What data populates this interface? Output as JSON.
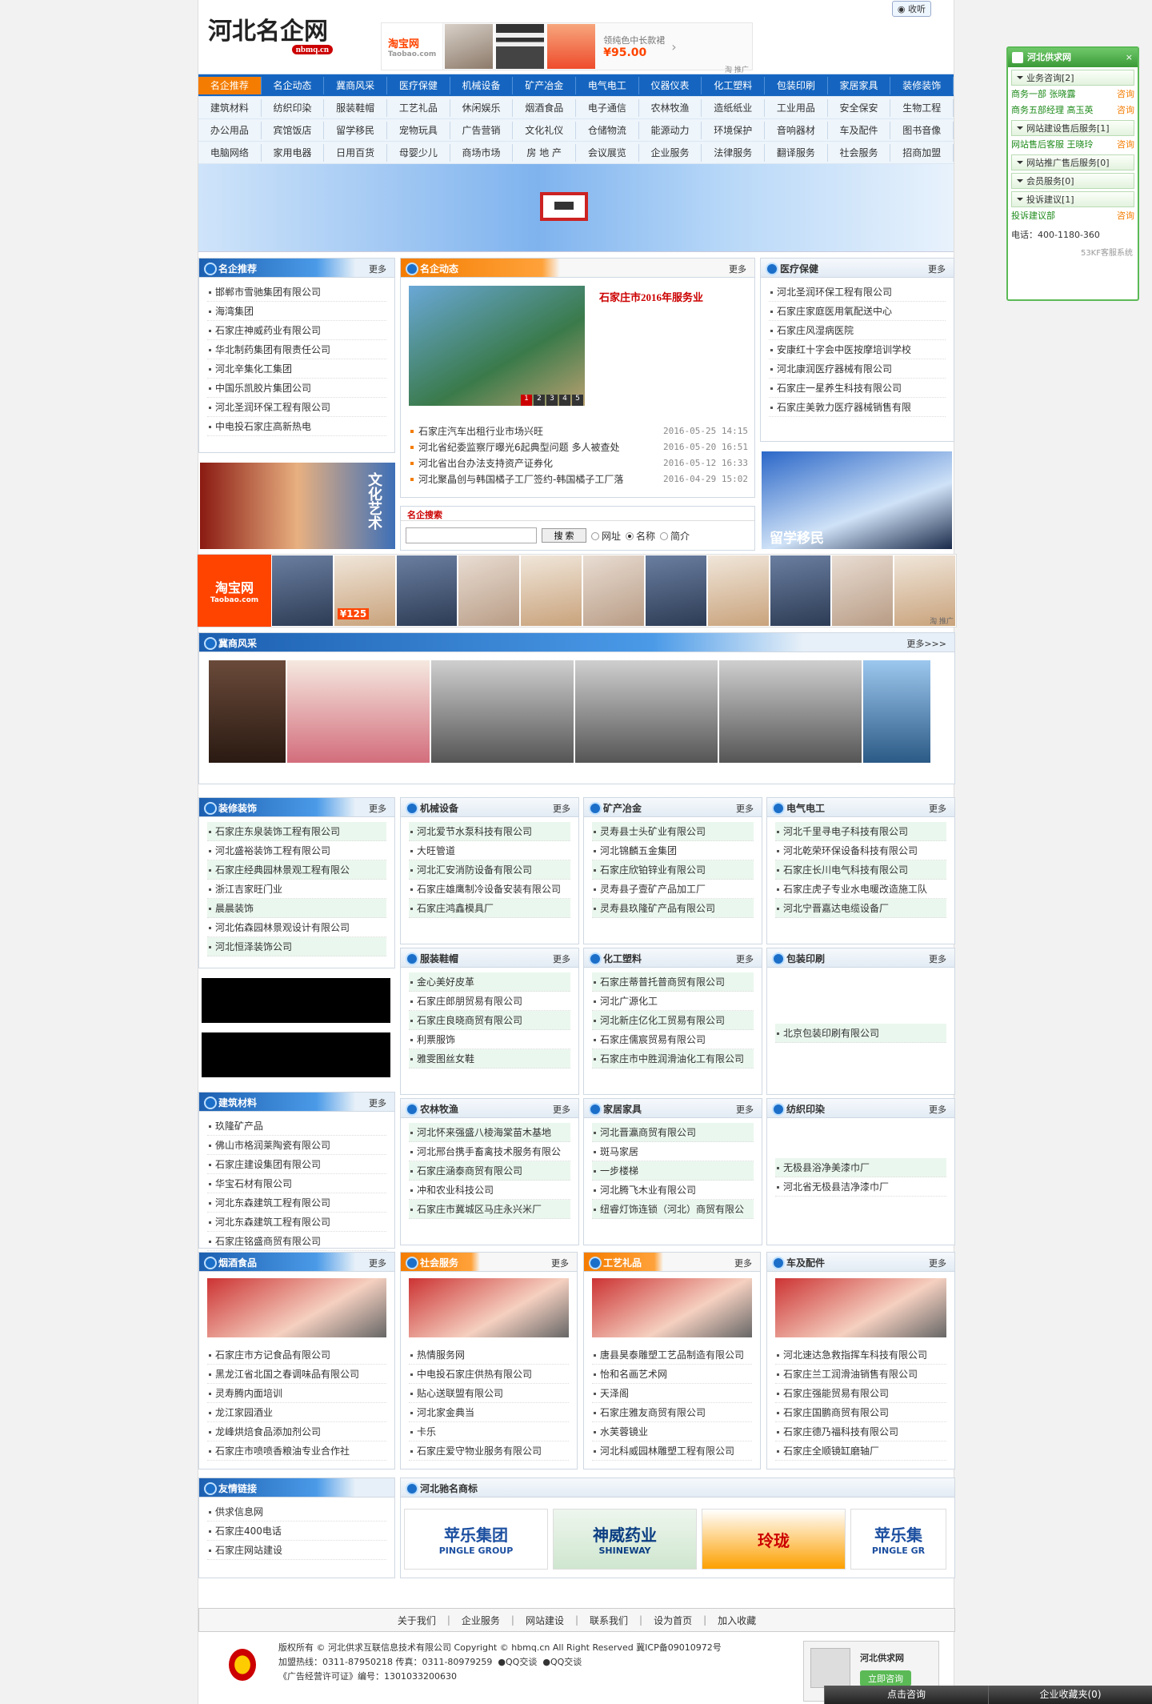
{
  "header": {
    "logo_text": "河北名企网",
    "logo_domain": "nbmq.cn",
    "banner_brand": "淘宝网",
    "banner_brand_sub": "Taobao.com",
    "banner_caption": "领纯色中长款裙",
    "banner_price": "¥95.00",
    "banner_ad_mark": "淘 推广",
    "listen_label": "收听"
  },
  "nav": {
    "rows": [
      [
        "名企推荐",
        "名企动态",
        "冀商风采",
        "医疗保健",
        "机械设备",
        "矿产冶金",
        "电气电工",
        "仪器仪表",
        "化工塑料",
        "包装印刷",
        "家居家具",
        "装修装饰"
      ],
      [
        "建筑材料",
        "纺织印染",
        "服装鞋帽",
        "工艺礼品",
        "休闲娱乐",
        "烟酒食品",
        "电子通信",
        "农林牧渔",
        "造纸纸业",
        "工业用品",
        "安全保安",
        "生物工程"
      ],
      [
        "办公用品",
        "宾馆饭店",
        "留学移民",
        "宠物玩具",
        "广告营销",
        "文化礼仪",
        "仓储物流",
        "能源动力",
        "环境保护",
        "音响器材",
        "车及配件",
        "图书音像"
      ],
      [
        "电脑网络",
        "家用电器",
        "日用百货",
        "母婴少儿",
        "商场市场",
        "房 地 产",
        "会议展览",
        "企业服务",
        "法律服务",
        "翻译服务",
        "社会服务",
        "招商加盟"
      ]
    ]
  },
  "more": "更多",
  "more_arrows": "更多>>>",
  "mingqi_tuijian": {
    "title": "名企推荐",
    "items": [
      "邯郸市雪驰集团有限公司",
      "海湾集团",
      "石家庄神威药业有限公司",
      "华北制药集团有限责任公司",
      "河北辛集化工集团",
      "中国乐凯胶片集团公司",
      "河北圣润环保工程有限公司",
      "中电投石家庄高新热电"
    ]
  },
  "mingqi_dongtai": {
    "title": "名企动态",
    "headline": "石家庄市2016年服务业",
    "slides": [
      "1",
      "2",
      "3",
      "4",
      "5"
    ],
    "news": [
      {
        "t": "石家庄汽车出租行业市场兴旺",
        "d": "2016-05-25 14:15"
      },
      {
        "t": "河北省纪委监察厅曝光6起典型问题 多人被查处",
        "d": "2016-05-20 16:51"
      },
      {
        "t": "河北省出台办法支持资产证券化",
        "d": "2016-05-12 16:33"
      },
      {
        "t": "河北聚晶创与韩国橘子工厂签约-韩国橘子工厂落",
        "d": "2016-04-29 15:02"
      }
    ]
  },
  "search": {
    "title": "名企搜索",
    "button": "搜 索",
    "options": [
      "网址",
      "名称",
      "简介"
    ]
  },
  "yiliao": {
    "title": "医疗保健",
    "items": [
      "河北圣润环保工程有限公司",
      "石家庄家庭医用氧配送中心",
      "石家庄风湿病医院",
      "安康红十字会中医按摩培训学校",
      "河北康润医疗器械有限公司",
      "石家庄一星养生科技有限公司",
      "石家庄美敦力医疗器械销售有限"
    ]
  },
  "left_ad_label": "文化艺术",
  "right_ad_label": "留学移民",
  "strip": {
    "brand": "淘宝网",
    "brand_sub": "Taobao.com",
    "price": "¥125",
    "mark": "淘 推广"
  },
  "jishang": {
    "title": "冀商风采"
  },
  "sections": {
    "zhuangxiu": {
      "title": "装修装饰",
      "items": [
        "石家庄东泉装饰工程有限公司",
        "河北盛裕装饰工程有限公司",
        "石家庄经典园林景观工程有限公",
        "浙江吉家旺门业",
        "晨晨装饰",
        "河北佑森园林景观设计有限公司",
        "河北恒泽装饰公司"
      ]
    },
    "jixie": {
      "title": "机械设备",
      "items": [
        "河北爱节水泵科技有限公司",
        "大旺管道",
        "河北汇安消防设备有限公司",
        "石家庄雄鹰制冷设备安装有限公司",
        "石家庄鸿鑫模具厂"
      ]
    },
    "kuangchan": {
      "title": "矿产冶金",
      "items": [
        "灵寿县士头矿业有限公司",
        "河北锦麟五金集团",
        "石家庄欣铂锌业有限公司",
        "灵寿县子壹矿产品加工厂",
        "灵寿县玖隆矿产品有限公司"
      ]
    },
    "dianqi": {
      "title": "电气电工",
      "items": [
        "河北千里寻电子科技有限公司",
        "河北乾荣环保设备科技有限公司",
        "石家庄长川电气科技有限公司",
        "石家庄虎子专业水电暖改造施工队",
        "河北宁晋嘉达电缆设备厂"
      ]
    },
    "fuzhuang": {
      "title": "服装鞋帽",
      "items": [
        "金心美好皮革",
        "石家庄郎朋贸易有限公司",
        "石家庄良晓商贸有限公司",
        "利票服饰",
        "雅雯图丝女鞋"
      ]
    },
    "huagong": {
      "title": "化工塑料",
      "items": [
        "石家庄蒂普托普商贸有限公司",
        "河北广源化工",
        "河北新庄亿化工贸易有限公司",
        "石家庄儒宸贸易有限公司",
        "石家庄市中胜润滑油化工有限公司"
      ]
    },
    "baozhuang": {
      "title": "包装印刷",
      "items": [
        "北京包装印刷有限公司"
      ]
    },
    "jianzhu": {
      "title": "建筑材料",
      "items": [
        "玖隆矿产品",
        "佛山市格润莱陶瓷有限公司",
        "石家庄建设集团有限公司",
        "华宝石材有限公司",
        "河北东森建筑工程有限公司",
        "河北东森建筑工程有限公司",
        "石家庄铭盛商贸有限公司"
      ]
    },
    "nonglin": {
      "title": "农林牧渔",
      "items": [
        "河北怀来强盛八棱海棠苗木基地",
        "河北邢台携手畜禽技术服务有限公",
        "石家庄涵泰商贸有限公司",
        "冲和农业科技公司",
        "石家庄市冀城区马庄永兴米厂"
      ]
    },
    "jiaju": {
      "title": "家居家具",
      "items": [
        "河北晋瀛商贸有限公司",
        "斑马家居",
        "一步楼梯",
        "河北腾飞木业有限公司",
        "纽睿灯饰连锁（河北）商贸有限公"
      ]
    },
    "fangzhi": {
      "title": "纺织印染",
      "items": [
        "无极县浴净美漆巾厂",
        "河北省无极县洁净漆巾厂"
      ]
    },
    "yanjiu": {
      "title": "烟酒食品",
      "items": [
        "石家庄市方记食品有限公司",
        "黑龙江省北国之春调味品有限公司",
        "灵寿腾内面培训",
        "龙江家园酒业",
        "龙峰烘焙食品添加剂公司",
        "石家庄市喷喷香粮油专业合作社"
      ]
    },
    "shehui": {
      "title": "社会服务",
      "items": [
        "热情服务网",
        "中电投石家庄供热有限公司",
        "贴心送联盟有限公司",
        "河北家金典当",
        "卡乐",
        "石家庄爱守物业服务有限公司"
      ]
    },
    "gongyi": {
      "title": "工艺礼品",
      "items": [
        "唐县昊泰雕塑工艺品制造有限公司",
        "怡和名画艺术网",
        "天泽阁",
        "石家庄雅友商贸有限公司",
        "水芙蓉镜业",
        "河北科威园林雕塑工程有限公司"
      ]
    },
    "chepei": {
      "title": "车及配件",
      "items": [
        "河北速达急救指挥车科技有限公司",
        "石家庄兰工润滑油销售有限公司",
        "石家庄强能贸易有限公司",
        "石家庄国鹏商贸有限公司",
        "石家庄德乃福科技有限公司",
        "石家庄全顺镜缸磨轴厂"
      ]
    },
    "youqing": {
      "title": "友情链接",
      "items": [
        "供求信息网",
        "石家庄400电话",
        "石家庄网站建设"
      ]
    },
    "shangbiao": {
      "title": "河北驰名商标",
      "logos": [
        "苹乐集团",
        "神威药业",
        "玲珑",
        "苹乐集"
      ],
      "logo_subs": [
        "PINGLE GROUP",
        "SHINEWAY",
        "",
        "PINGLE GR"
      ]
    }
  },
  "footer": {
    "links": [
      "关于我们",
      "企业服务",
      "网站建设",
      "联系我们",
      "设为首页",
      "加入收藏"
    ],
    "line1": "版权所有 © 河北供求互联信息技术有限公司  Copyright © hbmq.cn All Right Reserved  冀ICP备09010972号",
    "line2": "加盟热线：0311-87950218  传真：0311-80979259",
    "qq1": "QQ交谈",
    "qq2": "QQ交谈",
    "line3": "《广告经营许可证》编号：1301033200630",
    "kf_title": "河北供求网",
    "kf_btn": "立即咨询"
  },
  "kf": {
    "title": "河北供求网",
    "close": "×",
    "groups": [
      {
        "name": "业务咨询[2]",
        "rows": [
          {
            "a": "商务一部 张晓露",
            "b": "咨询"
          },
          {
            "a": "商务五部经理 高玉英",
            "b": "咨询"
          }
        ]
      },
      {
        "name": "网站建设售后服务[1]",
        "rows": [
          {
            "a": "网站售后客服 王晓玲",
            "b": "咨询"
          }
        ]
      },
      {
        "name": "网站推广售后服务[0]",
        "rows": []
      },
      {
        "name": "会员服务[0]",
        "rows": []
      },
      {
        "name": "投诉建议[1]",
        "rows": [
          {
            "a": "投诉建议部",
            "b": "咨询"
          }
        ]
      }
    ],
    "tel": "电话：400-1180-360",
    "brand": "53KF客服系统"
  },
  "bottombar": [
    "点击咨询",
    "企业收藏夹(0)"
  ]
}
